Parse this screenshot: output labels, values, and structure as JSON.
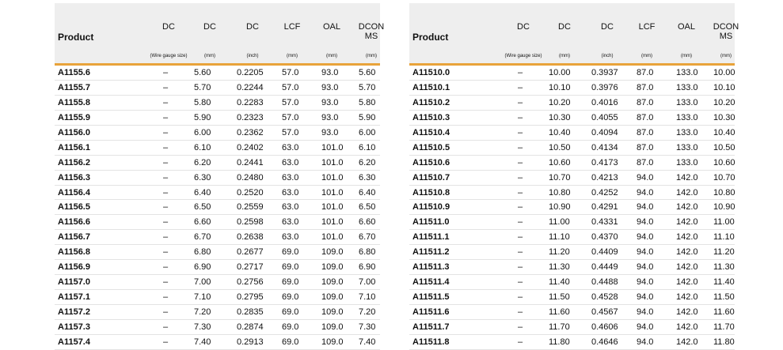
{
  "left": {
    "header": {
      "product": "Product",
      "columns": [
        {
          "name": "DC",
          "unit": "(Wire gauge size)"
        },
        {
          "name": "DC",
          "unit": "(mm)"
        },
        {
          "name": "DC",
          "unit": "(inch)"
        },
        {
          "name": "LCF",
          "unit": "(mm)"
        },
        {
          "name": "OAL",
          "unit": "(mm)"
        },
        {
          "name": "DCON MS",
          "unit": "(mm)"
        }
      ]
    },
    "rows": [
      [
        "A1155.6",
        "–",
        "5.60",
        "0.2205",
        "57.0",
        "93.0",
        "5.60"
      ],
      [
        "A1155.7",
        "–",
        "5.70",
        "0.2244",
        "57.0",
        "93.0",
        "5.70"
      ],
      [
        "A1155.8",
        "–",
        "5.80",
        "0.2283",
        "57.0",
        "93.0",
        "5.80"
      ],
      [
        "A1155.9",
        "–",
        "5.90",
        "0.2323",
        "57.0",
        "93.0",
        "5.90"
      ],
      [
        "A1156.0",
        "–",
        "6.00",
        "0.2362",
        "57.0",
        "93.0",
        "6.00"
      ],
      [
        "A1156.1",
        "–",
        "6.10",
        "0.2402",
        "63.0",
        "101.0",
        "6.10"
      ],
      [
        "A1156.2",
        "–",
        "6.20",
        "0.2441",
        "63.0",
        "101.0",
        "6.20"
      ],
      [
        "A1156.3",
        "–",
        "6.30",
        "0.2480",
        "63.0",
        "101.0",
        "6.30"
      ],
      [
        "A1156.4",
        "–",
        "6.40",
        "0.2520",
        "63.0",
        "101.0",
        "6.40"
      ],
      [
        "A1156.5",
        "–",
        "6.50",
        "0.2559",
        "63.0",
        "101.0",
        "6.50"
      ],
      [
        "A1156.6",
        "–",
        "6.60",
        "0.2598",
        "63.0",
        "101.0",
        "6.60"
      ],
      [
        "A1156.7",
        "–",
        "6.70",
        "0.2638",
        "63.0",
        "101.0",
        "6.70"
      ],
      [
        "A1156.8",
        "–",
        "6.80",
        "0.2677",
        "69.0",
        "109.0",
        "6.80"
      ],
      [
        "A1156.9",
        "–",
        "6.90",
        "0.2717",
        "69.0",
        "109.0",
        "6.90"
      ],
      [
        "A1157.0",
        "–",
        "7.00",
        "0.2756",
        "69.0",
        "109.0",
        "7.00"
      ],
      [
        "A1157.1",
        "–",
        "7.10",
        "0.2795",
        "69.0",
        "109.0",
        "7.10"
      ],
      [
        "A1157.2",
        "–",
        "7.20",
        "0.2835",
        "69.0",
        "109.0",
        "7.20"
      ],
      [
        "A1157.3",
        "–",
        "7.30",
        "0.2874",
        "69.0",
        "109.0",
        "7.30"
      ],
      [
        "A1157.4",
        "–",
        "7.40",
        "0.2913",
        "69.0",
        "109.0",
        "7.40"
      ]
    ]
  },
  "right": {
    "header": {
      "product": "Product",
      "columns": [
        {
          "name": "DC",
          "unit": "(Wire gauge size)"
        },
        {
          "name": "DC",
          "unit": "(mm)"
        },
        {
          "name": "DC",
          "unit": "(inch)"
        },
        {
          "name": "LCF",
          "unit": "(mm)"
        },
        {
          "name": "OAL",
          "unit": "(mm)"
        },
        {
          "name": "DCON MS",
          "unit": "(mm)"
        }
      ]
    },
    "rows": [
      [
        "A11510.0",
        "–",
        "10.00",
        "0.3937",
        "87.0",
        "133.0",
        "10.00"
      ],
      [
        "A11510.1",
        "–",
        "10.10",
        "0.3976",
        "87.0",
        "133.0",
        "10.10"
      ],
      [
        "A11510.2",
        "–",
        "10.20",
        "0.4016",
        "87.0",
        "133.0",
        "10.20"
      ],
      [
        "A11510.3",
        "–",
        "10.30",
        "0.4055",
        "87.0",
        "133.0",
        "10.30"
      ],
      [
        "A11510.4",
        "–",
        "10.40",
        "0.4094",
        "87.0",
        "133.0",
        "10.40"
      ],
      [
        "A11510.5",
        "–",
        "10.50",
        "0.4134",
        "87.0",
        "133.0",
        "10.50"
      ],
      [
        "A11510.6",
        "–",
        "10.60",
        "0.4173",
        "87.0",
        "133.0",
        "10.60"
      ],
      [
        "A11510.7",
        "–",
        "10.70",
        "0.4213",
        "94.0",
        "142.0",
        "10.70"
      ],
      [
        "A11510.8",
        "–",
        "10.80",
        "0.4252",
        "94.0",
        "142.0",
        "10.80"
      ],
      [
        "A11510.9",
        "–",
        "10.90",
        "0.4291",
        "94.0",
        "142.0",
        "10.90"
      ],
      [
        "A11511.0",
        "–",
        "11.00",
        "0.4331",
        "94.0",
        "142.0",
        "11.00"
      ],
      [
        "A11511.1",
        "–",
        "11.10",
        "0.4370",
        "94.0",
        "142.0",
        "11.10"
      ],
      [
        "A11511.2",
        "–",
        "11.20",
        "0.4409",
        "94.0",
        "142.0",
        "11.20"
      ],
      [
        "A11511.3",
        "–",
        "11.30",
        "0.4449",
        "94.0",
        "142.0",
        "11.30"
      ],
      [
        "A11511.4",
        "–",
        "11.40",
        "0.4488",
        "94.0",
        "142.0",
        "11.40"
      ],
      [
        "A11511.5",
        "–",
        "11.50",
        "0.4528",
        "94.0",
        "142.0",
        "11.50"
      ],
      [
        "A11511.6",
        "–",
        "11.60",
        "0.4567",
        "94.0",
        "142.0",
        "11.60"
      ],
      [
        "A11511.7",
        "–",
        "11.70",
        "0.4606",
        "94.0",
        "142.0",
        "11.70"
      ],
      [
        "A11511.8",
        "–",
        "11.80",
        "0.4646",
        "94.0",
        "142.0",
        "11.80"
      ]
    ]
  }
}
